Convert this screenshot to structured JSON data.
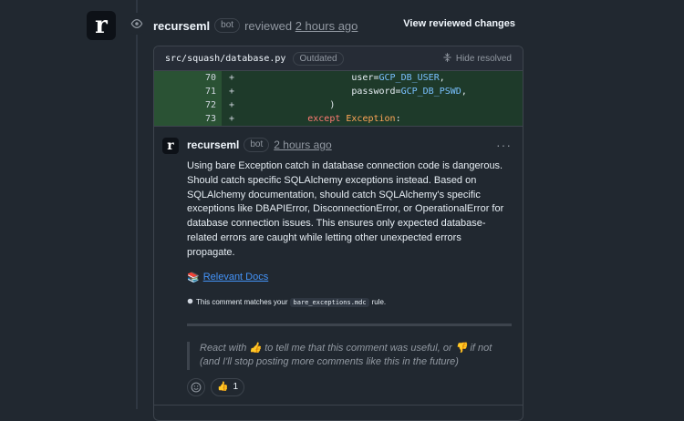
{
  "review": {
    "avatar_letter": "r",
    "user": "recurseml",
    "bot_badge": "bot",
    "action": "reviewed",
    "time": "2 hours ago",
    "view_changes": "View reviewed changes"
  },
  "file": {
    "path": "src/squash/database.py",
    "badge": "Outdated",
    "hide_resolved": "Hide resolved"
  },
  "diff": [
    {
      "line": "70",
      "sign": "+"
    },
    {
      "line": "71",
      "sign": "+"
    },
    {
      "line": "72",
      "sign": "+"
    },
    {
      "line": "73",
      "sign": "+"
    }
  ],
  "code": {
    "l70_attr": "user=",
    "l70_val": "GCP_DB_USER",
    "l70_end": ",",
    "l71_attr": "password=",
    "l71_val": "GCP_DB_PSWD",
    "l71_end": ",",
    "l72_text": ")",
    "l73_kw": "except",
    "l73_cls": "Exception",
    "l73_end": ":"
  },
  "comment": {
    "avatar_letter": "r",
    "user": "recurseml",
    "bot_badge": "bot",
    "time": "2 hours ago",
    "menu": "···",
    "body": "Using bare Exception catch in database connection code is dangerous. Should catch specific SQLAlchemy exceptions instead. Based on SQLAlchemy documentation, should catch SQLAlchemy's specific exceptions like DBAPIError, DisconnectionError, or OperationalError for database connection issues. This ensures only expected database-related errors are caught while letting other unexpected errors propagate.",
    "docs_emoji": "📚",
    "docs_link": "Relevant Docs",
    "rule_prefix": "This comment matches your",
    "rule_name": "bare_exceptions.mdc",
    "rule_suffix": "rule.",
    "react_part1": "React with",
    "react_up": "👍",
    "react_part2": "to tell me that this comment was useful, or",
    "react_down": "👎",
    "react_part3": "if not (and I'll stop posting more comments like this in the future)",
    "reaction_emoji": "👍",
    "reaction_count": "1"
  }
}
